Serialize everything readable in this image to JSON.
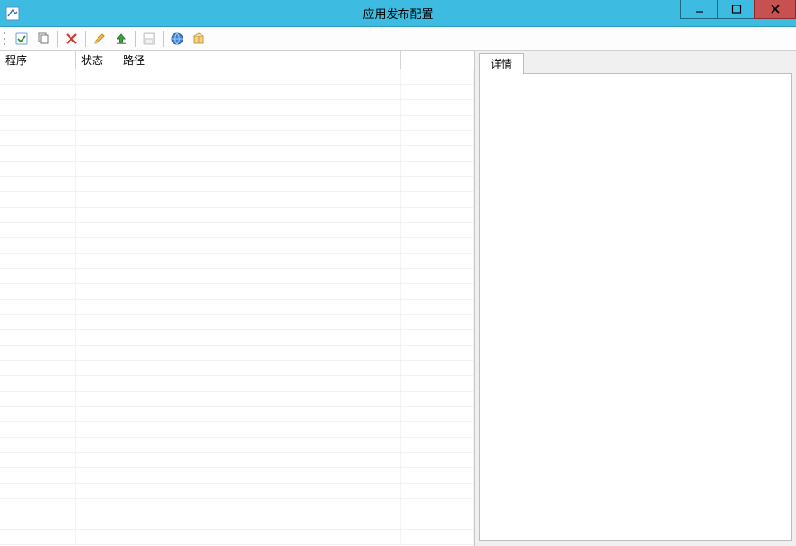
{
  "window": {
    "title": "应用发布配置"
  },
  "toolbar": {
    "items": [
      {
        "icon": "checklist",
        "label": "Checklist"
      },
      {
        "icon": "copy",
        "label": "Copy"
      },
      {
        "sep": true
      },
      {
        "icon": "delete",
        "label": "Delete"
      },
      {
        "sep": true
      },
      {
        "icon": "edit",
        "label": "Edit"
      },
      {
        "icon": "upload",
        "label": "Upload"
      },
      {
        "sep": true
      },
      {
        "icon": "save",
        "label": "Save",
        "disabled": true
      },
      {
        "sep": true
      },
      {
        "icon": "globe",
        "label": "Web"
      },
      {
        "icon": "box",
        "label": "Package"
      }
    ]
  },
  "table": {
    "columns": [
      "程序",
      "状态",
      "路径",
      ""
    ],
    "rows": []
  },
  "details": {
    "tab_label": "详情"
  }
}
